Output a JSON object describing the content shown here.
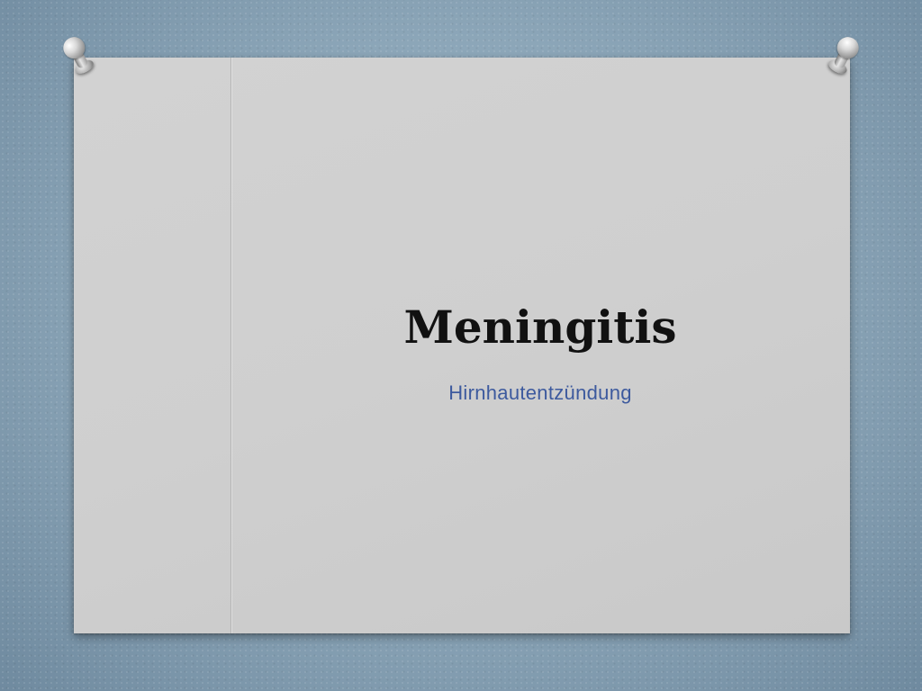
{
  "slide": {
    "title": "Meningitis",
    "subtitle": "Hirnhautentzündung"
  },
  "colors": {
    "title": "#111111",
    "subtitle": "#3d5a9e",
    "panel": "#d0d0d0",
    "background": "#8fa9bb"
  },
  "decor": {
    "pins": [
      "pushpin-icon",
      "pushpin-icon"
    ]
  }
}
